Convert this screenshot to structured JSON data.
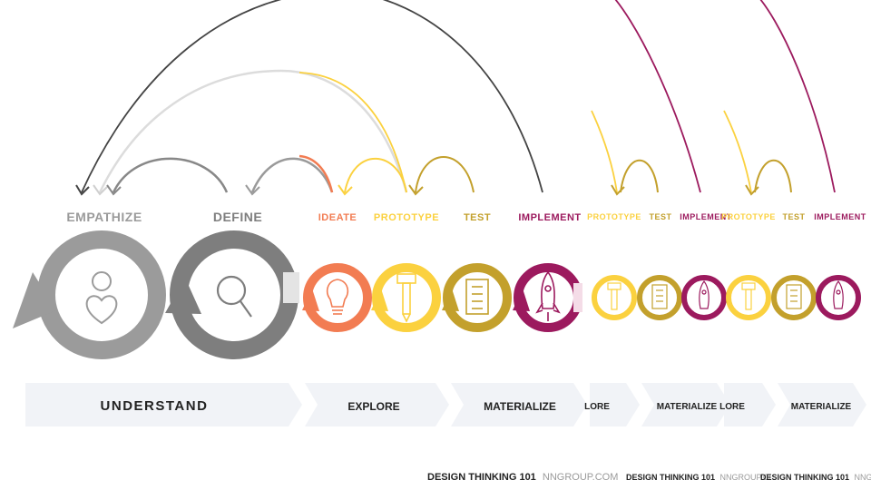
{
  "colors": {
    "empathize": "#9b9b9b",
    "define": "#7e7e7e",
    "ideate": "#f27c52",
    "prototype": "#fbd13f",
    "test": "#c3a02c",
    "implement": "#9c1a5e",
    "phase_bg": "#f1f3f7",
    "phase_text": "#222222",
    "footer_gray": "#9a9a9a"
  },
  "main": {
    "stages": [
      {
        "id": "empathize",
        "label": "EMPATHIZE",
        "icon": "heart-person-icon"
      },
      {
        "id": "define",
        "label": "DEFINE",
        "icon": "magnifier-icon"
      },
      {
        "id": "ideate",
        "label": "IDEATE",
        "icon": "lightbulb-icon"
      },
      {
        "id": "prototype",
        "label": "PROTOTYPE",
        "icon": "hammer-icon"
      },
      {
        "id": "test",
        "label": "TEST",
        "icon": "checklist-icon"
      },
      {
        "id": "implement",
        "label": "IMPLEMENT",
        "icon": "rocket-icon"
      }
    ],
    "phases": [
      {
        "label": "UNDERSTAND"
      },
      {
        "label": "EXPLORE"
      },
      {
        "label": "MATERIALIZE"
      }
    ],
    "footer": {
      "bold": "DESIGN THINKING 101",
      "light": "NNGROUP.COM"
    }
  },
  "repeat": [
    {
      "stages": [
        {
          "id": "prototype",
          "label": "PROTOTYPE",
          "icon": "hammer-icon"
        },
        {
          "id": "test",
          "label": "TEST",
          "icon": "checklist-icon"
        },
        {
          "id": "implement",
          "label": "IMPLEMENT",
          "icon": "rocket-icon"
        }
      ],
      "phases": [
        {
          "label": "LORE"
        },
        {
          "label": "MATERIALIZE"
        }
      ],
      "footer": {
        "bold": "DESIGN THINKING 101",
        "light": "NNGROUP.CI"
      }
    },
    {
      "stages": [
        {
          "id": "prototype",
          "label": "PROTOTYPE",
          "icon": "hammer-icon"
        },
        {
          "id": "test",
          "label": "TEST",
          "icon": "checklist-icon"
        },
        {
          "id": "implement",
          "label": "IMPLEMENT",
          "icon": "rocket-icon"
        }
      ],
      "phases": [
        {
          "label": "LORE"
        },
        {
          "label": "MATERIALIZE"
        }
      ],
      "footer": {
        "bold": "DESIGN THINKING 101",
        "light": "NNGROUP.COM"
      }
    }
  ]
}
